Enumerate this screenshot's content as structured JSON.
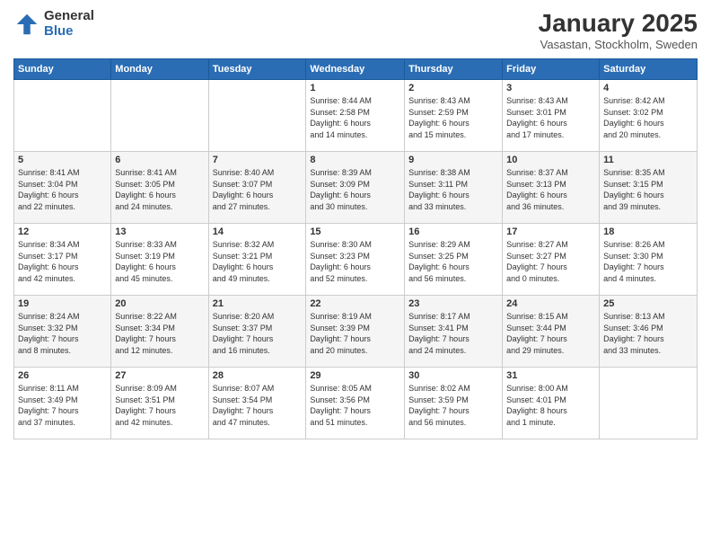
{
  "logo": {
    "general": "General",
    "blue": "Blue"
  },
  "title": {
    "month": "January 2025",
    "location": "Vasastan, Stockholm, Sweden"
  },
  "days_of_week": [
    "Sunday",
    "Monday",
    "Tuesday",
    "Wednesday",
    "Thursday",
    "Friday",
    "Saturday"
  ],
  "weeks": [
    [
      {
        "day": "",
        "info": ""
      },
      {
        "day": "",
        "info": ""
      },
      {
        "day": "",
        "info": ""
      },
      {
        "day": "1",
        "info": "Sunrise: 8:44 AM\nSunset: 2:58 PM\nDaylight: 6 hours\nand 14 minutes."
      },
      {
        "day": "2",
        "info": "Sunrise: 8:43 AM\nSunset: 2:59 PM\nDaylight: 6 hours\nand 15 minutes."
      },
      {
        "day": "3",
        "info": "Sunrise: 8:43 AM\nSunset: 3:01 PM\nDaylight: 6 hours\nand 17 minutes."
      },
      {
        "day": "4",
        "info": "Sunrise: 8:42 AM\nSunset: 3:02 PM\nDaylight: 6 hours\nand 20 minutes."
      }
    ],
    [
      {
        "day": "5",
        "info": "Sunrise: 8:41 AM\nSunset: 3:04 PM\nDaylight: 6 hours\nand 22 minutes."
      },
      {
        "day": "6",
        "info": "Sunrise: 8:41 AM\nSunset: 3:05 PM\nDaylight: 6 hours\nand 24 minutes."
      },
      {
        "day": "7",
        "info": "Sunrise: 8:40 AM\nSunset: 3:07 PM\nDaylight: 6 hours\nand 27 minutes."
      },
      {
        "day": "8",
        "info": "Sunrise: 8:39 AM\nSunset: 3:09 PM\nDaylight: 6 hours\nand 30 minutes."
      },
      {
        "day": "9",
        "info": "Sunrise: 8:38 AM\nSunset: 3:11 PM\nDaylight: 6 hours\nand 33 minutes."
      },
      {
        "day": "10",
        "info": "Sunrise: 8:37 AM\nSunset: 3:13 PM\nDaylight: 6 hours\nand 36 minutes."
      },
      {
        "day": "11",
        "info": "Sunrise: 8:35 AM\nSunset: 3:15 PM\nDaylight: 6 hours\nand 39 minutes."
      }
    ],
    [
      {
        "day": "12",
        "info": "Sunrise: 8:34 AM\nSunset: 3:17 PM\nDaylight: 6 hours\nand 42 minutes."
      },
      {
        "day": "13",
        "info": "Sunrise: 8:33 AM\nSunset: 3:19 PM\nDaylight: 6 hours\nand 45 minutes."
      },
      {
        "day": "14",
        "info": "Sunrise: 8:32 AM\nSunset: 3:21 PM\nDaylight: 6 hours\nand 49 minutes."
      },
      {
        "day": "15",
        "info": "Sunrise: 8:30 AM\nSunset: 3:23 PM\nDaylight: 6 hours\nand 52 minutes."
      },
      {
        "day": "16",
        "info": "Sunrise: 8:29 AM\nSunset: 3:25 PM\nDaylight: 6 hours\nand 56 minutes."
      },
      {
        "day": "17",
        "info": "Sunrise: 8:27 AM\nSunset: 3:27 PM\nDaylight: 7 hours\nand 0 minutes."
      },
      {
        "day": "18",
        "info": "Sunrise: 8:26 AM\nSunset: 3:30 PM\nDaylight: 7 hours\nand 4 minutes."
      }
    ],
    [
      {
        "day": "19",
        "info": "Sunrise: 8:24 AM\nSunset: 3:32 PM\nDaylight: 7 hours\nand 8 minutes."
      },
      {
        "day": "20",
        "info": "Sunrise: 8:22 AM\nSunset: 3:34 PM\nDaylight: 7 hours\nand 12 minutes."
      },
      {
        "day": "21",
        "info": "Sunrise: 8:20 AM\nSunset: 3:37 PM\nDaylight: 7 hours\nand 16 minutes."
      },
      {
        "day": "22",
        "info": "Sunrise: 8:19 AM\nSunset: 3:39 PM\nDaylight: 7 hours\nand 20 minutes."
      },
      {
        "day": "23",
        "info": "Sunrise: 8:17 AM\nSunset: 3:41 PM\nDaylight: 7 hours\nand 24 minutes."
      },
      {
        "day": "24",
        "info": "Sunrise: 8:15 AM\nSunset: 3:44 PM\nDaylight: 7 hours\nand 29 minutes."
      },
      {
        "day": "25",
        "info": "Sunrise: 8:13 AM\nSunset: 3:46 PM\nDaylight: 7 hours\nand 33 minutes."
      }
    ],
    [
      {
        "day": "26",
        "info": "Sunrise: 8:11 AM\nSunset: 3:49 PM\nDaylight: 7 hours\nand 37 minutes."
      },
      {
        "day": "27",
        "info": "Sunrise: 8:09 AM\nSunset: 3:51 PM\nDaylight: 7 hours\nand 42 minutes."
      },
      {
        "day": "28",
        "info": "Sunrise: 8:07 AM\nSunset: 3:54 PM\nDaylight: 7 hours\nand 47 minutes."
      },
      {
        "day": "29",
        "info": "Sunrise: 8:05 AM\nSunset: 3:56 PM\nDaylight: 7 hours\nand 51 minutes."
      },
      {
        "day": "30",
        "info": "Sunrise: 8:02 AM\nSunset: 3:59 PM\nDaylight: 7 hours\nand 56 minutes."
      },
      {
        "day": "31",
        "info": "Sunrise: 8:00 AM\nSunset: 4:01 PM\nDaylight: 8 hours\nand 1 minute."
      },
      {
        "day": "",
        "info": ""
      }
    ]
  ]
}
